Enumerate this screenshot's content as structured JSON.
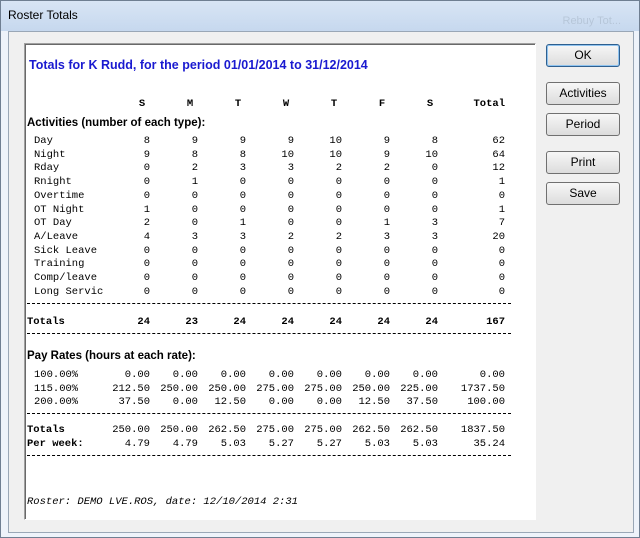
{
  "window": {
    "title": "Roster Totals",
    "background_title": "Rebuy Tot..."
  },
  "report": {
    "title": "Totals for K Rudd, for the period 01/01/2014 to 31/12/2014",
    "day_headers": [
      "S",
      "M",
      "T",
      "W",
      "T",
      "F",
      "S",
      "Total"
    ],
    "activities_heading": "Activities (number of each type):",
    "activities": [
      {
        "label": "Day",
        "values": [
          "8",
          "9",
          "9",
          "9",
          "10",
          "9",
          "8",
          "62"
        ]
      },
      {
        "label": "Night",
        "values": [
          "9",
          "8",
          "8",
          "10",
          "10",
          "9",
          "10",
          "64"
        ]
      },
      {
        "label": "Rday",
        "values": [
          "0",
          "2",
          "3",
          "3",
          "2",
          "2",
          "0",
          "12"
        ]
      },
      {
        "label": "Rnight",
        "values": [
          "0",
          "1",
          "0",
          "0",
          "0",
          "0",
          "0",
          "1"
        ]
      },
      {
        "label": "Overtime",
        "values": [
          "0",
          "0",
          "0",
          "0",
          "0",
          "0",
          "0",
          "0"
        ]
      },
      {
        "label": "OT Night",
        "values": [
          "1",
          "0",
          "0",
          "0",
          "0",
          "0",
          "0",
          "1"
        ]
      },
      {
        "label": "OT Day",
        "values": [
          "2",
          "0",
          "1",
          "0",
          "0",
          "1",
          "3",
          "7"
        ]
      },
      {
        "label": "A/Leave",
        "values": [
          "4",
          "3",
          "3",
          "2",
          "2",
          "3",
          "3",
          "20"
        ]
      },
      {
        "label": "Sick Leave",
        "values": [
          "0",
          "0",
          "0",
          "0",
          "0",
          "0",
          "0",
          "0"
        ]
      },
      {
        "label": "Training",
        "values": [
          "0",
          "0",
          "0",
          "0",
          "0",
          "0",
          "0",
          "0"
        ]
      },
      {
        "label": "Comp/leave",
        "values": [
          "0",
          "0",
          "0",
          "0",
          "0",
          "0",
          "0",
          "0"
        ]
      },
      {
        "label": "Long Servic",
        "values": [
          "0",
          "0",
          "0",
          "0",
          "0",
          "0",
          "0",
          "0"
        ]
      }
    ],
    "activity_totals": {
      "label": "Totals",
      "values": [
        "24",
        "23",
        "24",
        "24",
        "24",
        "24",
        "24",
        "167"
      ]
    },
    "payrates_heading": "Pay Rates (hours at each rate):",
    "payrates": [
      {
        "label": "100.00%",
        "values": [
          "0.00",
          "0.00",
          "0.00",
          "0.00",
          "0.00",
          "0.00",
          "0.00",
          "0.00"
        ]
      },
      {
        "label": "115.00%",
        "values": [
          "212.50",
          "250.00",
          "250.00",
          "275.00",
          "275.00",
          "250.00",
          "225.00",
          "1737.50"
        ]
      },
      {
        "label": "200.00%",
        "values": [
          "37.50",
          "0.00",
          "12.50",
          "0.00",
          "0.00",
          "12.50",
          "37.50",
          "100.00"
        ]
      }
    ],
    "payrate_totals": {
      "label": "Totals",
      "values": [
        "250.00",
        "250.00",
        "262.50",
        "275.00",
        "275.00",
        "262.50",
        "262.50",
        "1837.50"
      ]
    },
    "per_week": {
      "label": "Per week:",
      "values": [
        "4.79",
        "4.79",
        "5.03",
        "5.27",
        "5.27",
        "5.03",
        "5.03",
        "35.24"
      ]
    },
    "footer": "Roster: DEMO LVE.ROS, date: 12/10/2014  2:31"
  },
  "buttons": {
    "ok": "OK",
    "activities": "Activities",
    "period": "Period",
    "print": "Print",
    "save": "Save"
  }
}
